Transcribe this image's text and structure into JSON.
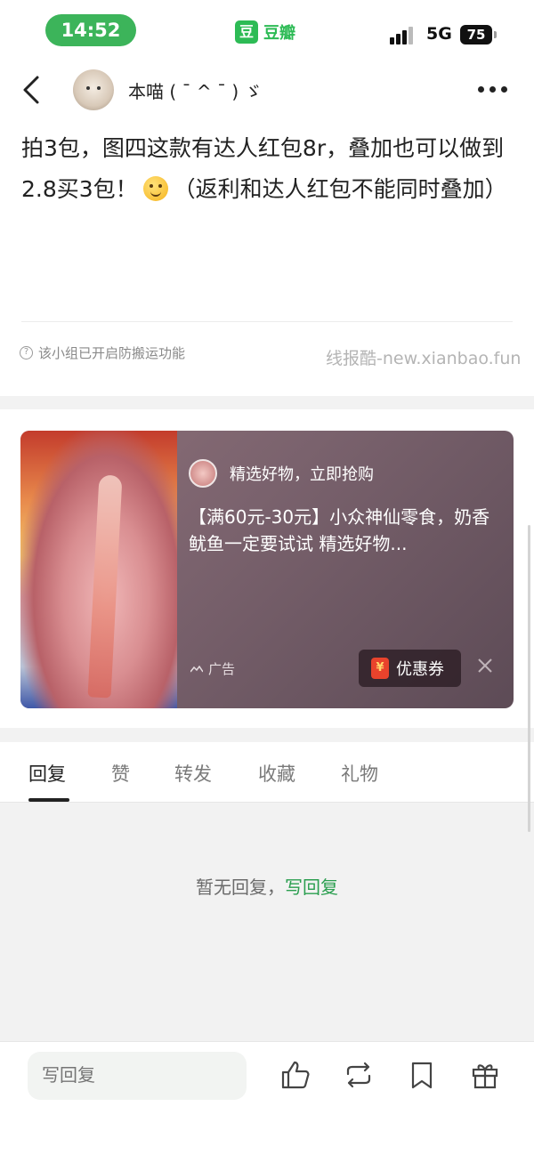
{
  "status_bar": {
    "time": "14:52",
    "app_name": "豆瓣",
    "app_logo": "豆",
    "network": "5G",
    "battery": "75"
  },
  "nav": {
    "username": "本喵 ( ˉ ^ ˉ ) ゞ"
  },
  "post": {
    "text_before_emoji": "拍3包，图四这款有达人红包8r，叠加也可以做到2.8买3包！",
    "text_after_emoji": "（返利和达人红包不能同时叠加）",
    "group_note": "该小组已开启防搬运功能",
    "watermark": "线报酷-new.xianbao.fun"
  },
  "ad": {
    "source_label": "精选好物，立即抢购",
    "title": "【满60元-30元】小众神仙零食，奶香鱿鱼一定要试试 精选好物...",
    "tag": "广告",
    "coupon_label": "优惠券",
    "coupon_glyph": "¥"
  },
  "tabs": [
    "回复",
    "赞",
    "转发",
    "收藏",
    "礼物"
  ],
  "empty_state": {
    "text": "暂无回复，",
    "action": "写回复"
  },
  "bottom_bar": {
    "reply_placeholder": "写回复"
  },
  "colors": {
    "accent_green": "#2dbb55",
    "link_green": "#2a9e4f",
    "status_pill": "#3cb45a"
  }
}
